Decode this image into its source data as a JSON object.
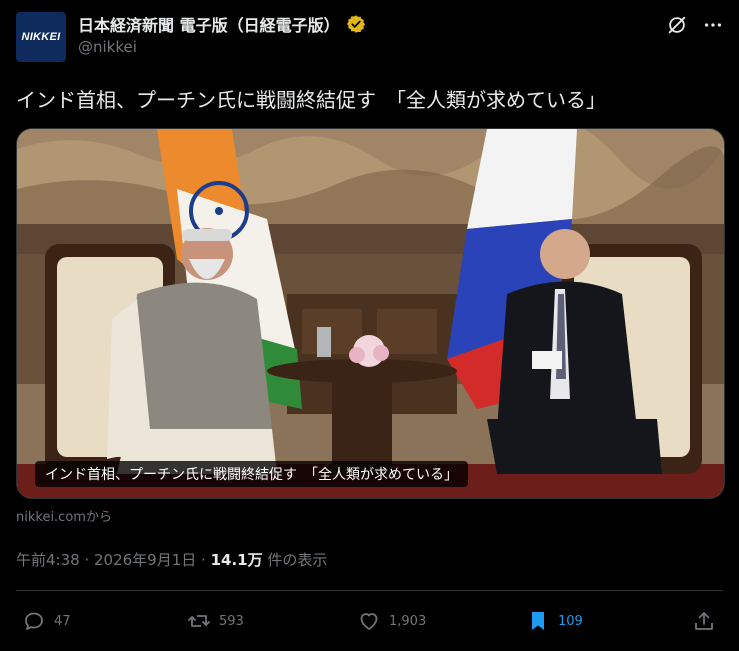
{
  "account": {
    "avatar_text": "NIKKEI",
    "display_name": "日本経済新聞 電子版（日経電子版）",
    "handle": "@nikkei"
  },
  "tweet": {
    "text": "インド首相、プーチン氏に戦闘終結促す　「全人類が求めている」"
  },
  "media": {
    "caption": "インド首相、プーチン氏に戦闘終結促す　「全人類が求めている」",
    "source": "nikkei.comから"
  },
  "meta": {
    "time": "午前4:38",
    "separator": " · ",
    "date": "2026年9月1日",
    "views_count": "14.1万",
    "views_label": " 件の表示"
  },
  "actions": {
    "replies": "47",
    "reposts": "593",
    "likes": "1,903",
    "bookmarks": "109"
  },
  "colors": {
    "accent": "#1d9bf0",
    "verified_gold": "#e2b719",
    "muted": "#71767b"
  },
  "icons": [
    "grok-icon",
    "more-icon",
    "reply-icon",
    "repost-icon",
    "like-icon",
    "bookmark-icon",
    "share-icon",
    "verified-badge-icon"
  ]
}
